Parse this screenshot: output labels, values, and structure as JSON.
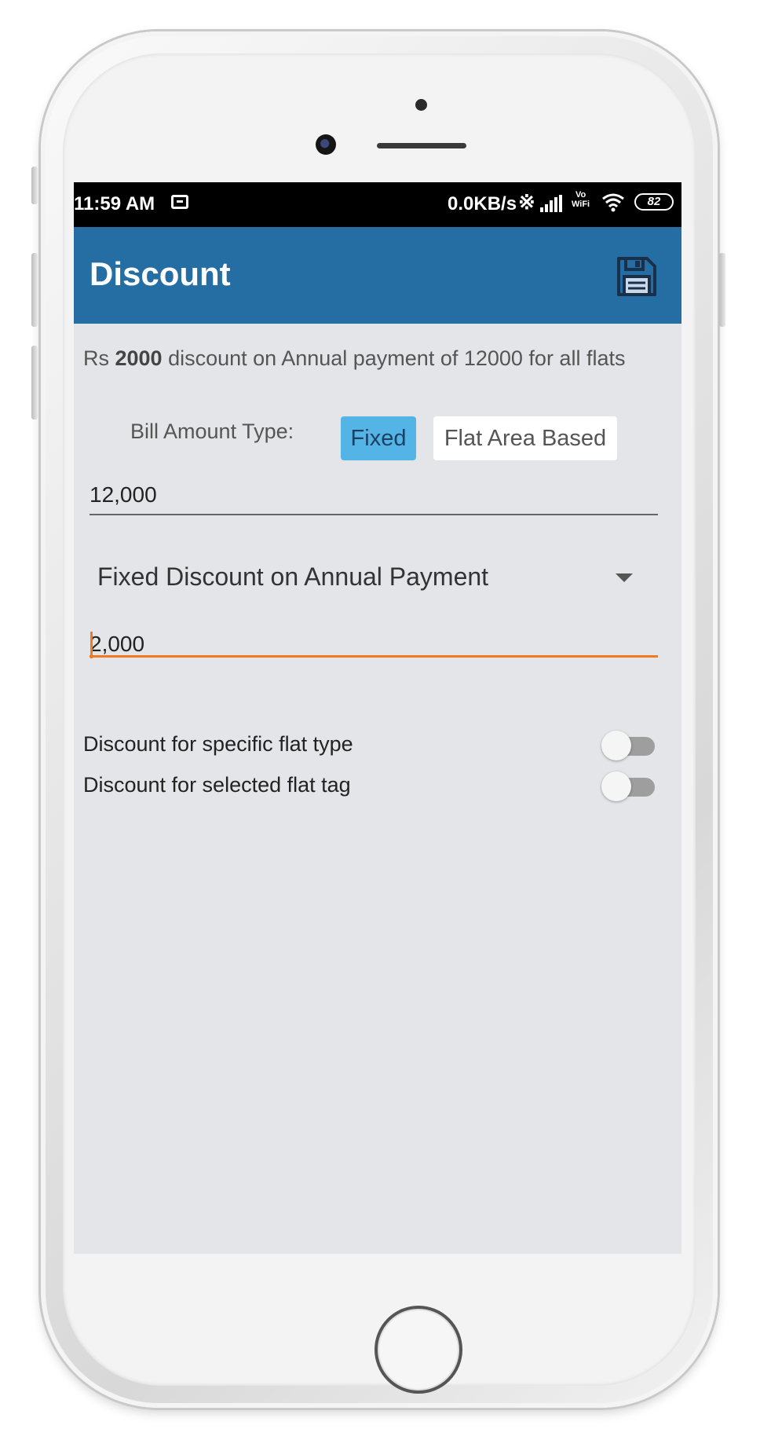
{
  "status_bar": {
    "time": "11:59 AM",
    "net_speed": "0.0KB/s",
    "volte_top": "Vo",
    "volte_bottom": "WiFi",
    "battery": "82"
  },
  "app_bar": {
    "title": "Discount",
    "save_icon": "save-icon"
  },
  "summary": {
    "prefix": "Rs ",
    "amount": "2000",
    "suffix": " discount on Annual payment of 12000 for all flats"
  },
  "bill_type": {
    "label": "Bill Amount Type:",
    "options": [
      "Fixed",
      "Flat Area Based"
    ],
    "selected": "Fixed"
  },
  "annual_payment": {
    "value": "12,000"
  },
  "discount_type": {
    "selected": "Fixed Discount on Annual Payment"
  },
  "discount_amount": {
    "value": "2,000"
  },
  "toggles": [
    {
      "label": "Discount for specific flat type",
      "on": false
    },
    {
      "label": "Discount for selected flat tag",
      "on": false
    }
  ],
  "colors": {
    "app_bar": "#246ea3",
    "screen_bg": "#e3e5e8",
    "selected_segment": "#55b4e6",
    "focus_accent": "#f07a22"
  }
}
